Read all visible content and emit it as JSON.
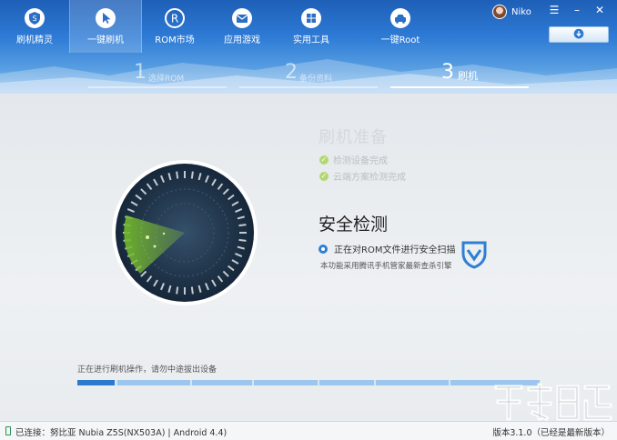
{
  "nav": {
    "items": [
      {
        "label": "刷机精灵",
        "icon": "shield-s-icon"
      },
      {
        "label": "一键刷机",
        "icon": "cursor-icon",
        "active": true
      },
      {
        "label": "ROM市场",
        "icon": "rom-r-icon"
      },
      {
        "label": "应用游戏",
        "icon": "mail-icon"
      },
      {
        "label": "实用工具",
        "icon": "grid-icon"
      },
      {
        "label": "一键Root",
        "icon": "car-icon"
      }
    ]
  },
  "user": {
    "name": "Niko"
  },
  "steps": [
    {
      "num": "1",
      "label": "选择ROM"
    },
    {
      "num": "2",
      "label": "备份资料"
    },
    {
      "num": "3",
      "label": "刷机",
      "active": true
    }
  ],
  "background_panel": {
    "title": "刷机准备",
    "checks": [
      "检测设备完成",
      "云端方案检测完成"
    ]
  },
  "security": {
    "title": "安全检测",
    "scan_status": "正在对ROM文件进行安全扫描",
    "note": "本功能采用腾讯手机管家最新查杀引擎"
  },
  "progress": {
    "label": "正在进行刷机操作，请勿中途拔出设备",
    "fraction": 0.08
  },
  "status": {
    "connection": "已连接：努比亚 Nubia Z5S(NX503A) | Android 4.4)",
    "version": "版本3.1.0（已经是最新版本）"
  },
  "colors": {
    "accent": "#2b7ad0",
    "check_green": "#b3d86f",
    "radar_green": "#8cc63f"
  }
}
